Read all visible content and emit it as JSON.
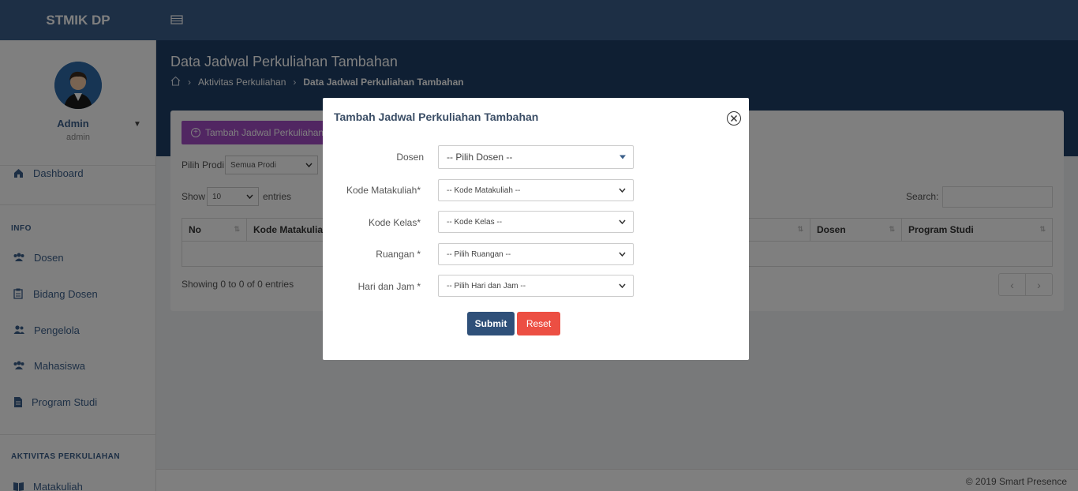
{
  "app": {
    "brand": "STMIK DP"
  },
  "user": {
    "name": "Admin",
    "role": "admin"
  },
  "sidebar": {
    "items": [
      {
        "label": "Dashboard",
        "icon": "home-icon"
      },
      {
        "label": "Dosen",
        "icon": "users-icon"
      },
      {
        "label": "Bidang Dosen",
        "icon": "clipboard-icon"
      },
      {
        "label": "Pengelola",
        "icon": "user-group-icon"
      },
      {
        "label": "Mahasiswa",
        "icon": "users-icon"
      },
      {
        "label": "Program Studi",
        "icon": "document-icon"
      },
      {
        "label": "Matakuliah",
        "icon": "book-icon"
      }
    ],
    "headers": {
      "info": "INFO",
      "aktivitas": "AKTIVITAS PERKULIAHAN"
    }
  },
  "page": {
    "title": "Data Jadwal Perkuliahan Tambahan",
    "breadcrumb": [
      "Aktivitas Perkuliahan",
      "Data Jadwal Perkuliahan Tambahan"
    ],
    "add_button": "Tambah Jadwal Perkuliahan Tambahan",
    "filter_label": "Pilih Prodi",
    "filter_value": "Semua Prodi",
    "show_label": "Show",
    "show_value": "10",
    "entries_label": "entries",
    "search_label": "Search:",
    "columns": [
      "No",
      "Kode Matakuliah",
      "",
      "Dosen",
      "Program Studi"
    ],
    "info": "Showing 0 to 0 of 0 entries",
    "pager": {
      "prev": "‹",
      "next": "›"
    }
  },
  "footer": {
    "text": "© 2019 Smart Presence"
  },
  "modal": {
    "title": "Tambah Jadwal Perkuliahan Tambahan",
    "fields": [
      {
        "label": "Dosen",
        "value": "-- Pilih Dosen --"
      },
      {
        "label": "Kode Matakuliah*",
        "value": "-- Kode Matakuliah --"
      },
      {
        "label": "Kode Kelas*",
        "value": "-- Kode Kelas --"
      },
      {
        "label": "Ruangan *",
        "value": "-- Pilih Ruangan --"
      },
      {
        "label": "Hari dan Jam *",
        "value": "-- Pilih Hari dan Jam --"
      }
    ],
    "submit": "Submit",
    "reset": "Reset"
  },
  "colors": {
    "topbar": "#3b5f8a",
    "hero": "#1f3f66",
    "add_button": "#a24cc4",
    "submit": "#2f5079",
    "reset": "#ec4f43"
  }
}
